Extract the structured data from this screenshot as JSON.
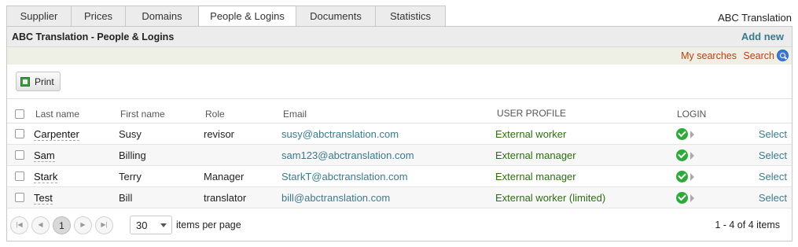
{
  "tabs": [
    {
      "label": "Supplier",
      "active": false
    },
    {
      "label": "Prices",
      "active": false
    },
    {
      "label": "Domains",
      "active": false
    },
    {
      "label": "People & Logins",
      "active": true
    },
    {
      "label": "Documents",
      "active": false
    },
    {
      "label": "Statistics",
      "active": false
    }
  ],
  "company_name": "ABC Translation",
  "panel": {
    "title": "ABC Translation - People & Logins",
    "add_new": "Add new",
    "my_searches": "My searches",
    "search": "Search",
    "search_icon": "search-icon"
  },
  "toolbar": {
    "print_label": "Print",
    "print_icon": "excel-icon"
  },
  "grid": {
    "headers": {
      "last_name": "Last name",
      "first_name": "First name",
      "role": "Role",
      "email": "Email",
      "user_profile": "USER PROFILE",
      "login": "LOGIN"
    },
    "rows": [
      {
        "last_name": "Carpenter",
        "first_name": "Susy",
        "role": "revisor",
        "email": "susy@abctranslation.com",
        "profile": "External worker",
        "login_active": true,
        "action": "Select"
      },
      {
        "last_name": "Sam",
        "first_name": "Billing",
        "role": "",
        "email": "sam123@abctranslation.com",
        "profile": "External manager",
        "login_active": true,
        "action": "Select"
      },
      {
        "last_name": "Stark",
        "first_name": "Terry",
        "role": "Manager",
        "email": "StarkT@abctranslation.com",
        "profile": "External manager",
        "login_active": true,
        "action": "Select"
      },
      {
        "last_name": "Test",
        "first_name": "Bill",
        "role": "translator",
        "email": "bill@abctranslation.com",
        "profile": "External worker (limited)",
        "login_active": true,
        "action": "Select"
      }
    ]
  },
  "pager": {
    "current_page": "1",
    "page_size": "30",
    "items_per_page_label": "items per page",
    "info": "1 - 4 of 4 items"
  },
  "colors": {
    "accent_link": "#3b7a8c",
    "search_link": "#b8420c",
    "profile_text": "#2b6e10",
    "login_ok": "#2eaa3a"
  }
}
